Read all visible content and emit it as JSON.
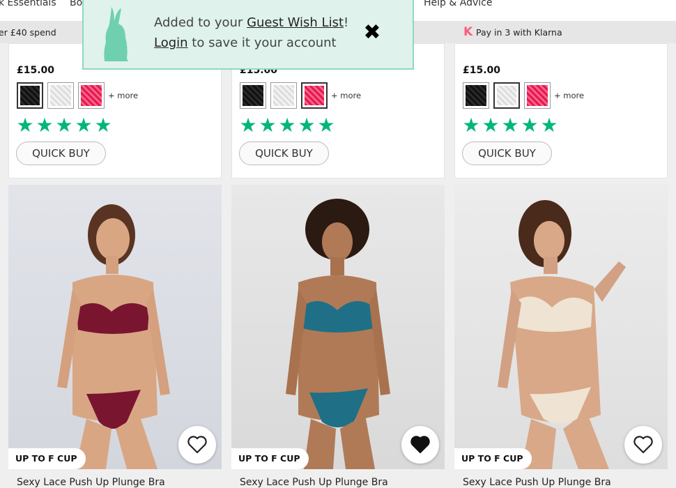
{
  "nav": {
    "items": [
      "k Essentials",
      "Bo",
      "Help & Advice"
    ]
  },
  "promo": {
    "left_text": "er £40 spend",
    "klarna_logo": "K",
    "klarna_text": "Pay in 3 with Klarna"
  },
  "toast": {
    "line1_prefix": "Added to your ",
    "wishlist_link": "Guest Wish List",
    "line1_suffix": "!",
    "login_link": "Login",
    "line2_suffix": " to save it your account",
    "close_icon": "close-icon",
    "mascot": "bunny-icon"
  },
  "products_top": [
    {
      "price": "£15.00",
      "more": "+ more",
      "quick_buy": "QUICK BUY",
      "rating": 5,
      "selected_swatch": 0
    },
    {
      "price": "£15.00",
      "more": "+ more",
      "quick_buy": "QUICK BUY",
      "rating": 5,
      "selected_swatch": 2
    },
    {
      "price": "£15.00",
      "more": "+ more",
      "quick_buy": "QUICK BUY",
      "rating": 5,
      "selected_swatch": 1
    }
  ],
  "products_bottom": [
    {
      "badge": "UP TO F CUP",
      "name": "Sexy Lace Push Up Plunge Bra",
      "wishlisted": false,
      "color": "#7a1530"
    },
    {
      "badge": "UP TO F CUP",
      "name": "Sexy Lace Push Up Plunge Bra",
      "wishlisted": true,
      "color": "#1f6f86"
    },
    {
      "badge": "UP TO F CUP",
      "name": "Sexy Lace Push Up Plunge Bra",
      "wishlisted": false,
      "color": "#efe3d3"
    }
  ],
  "colors": {
    "star_green": "#00b67a",
    "toast_bg": "#dff2ec",
    "toast_border": "#8fd8c2",
    "klarna_pink": "#ff5d7d"
  }
}
